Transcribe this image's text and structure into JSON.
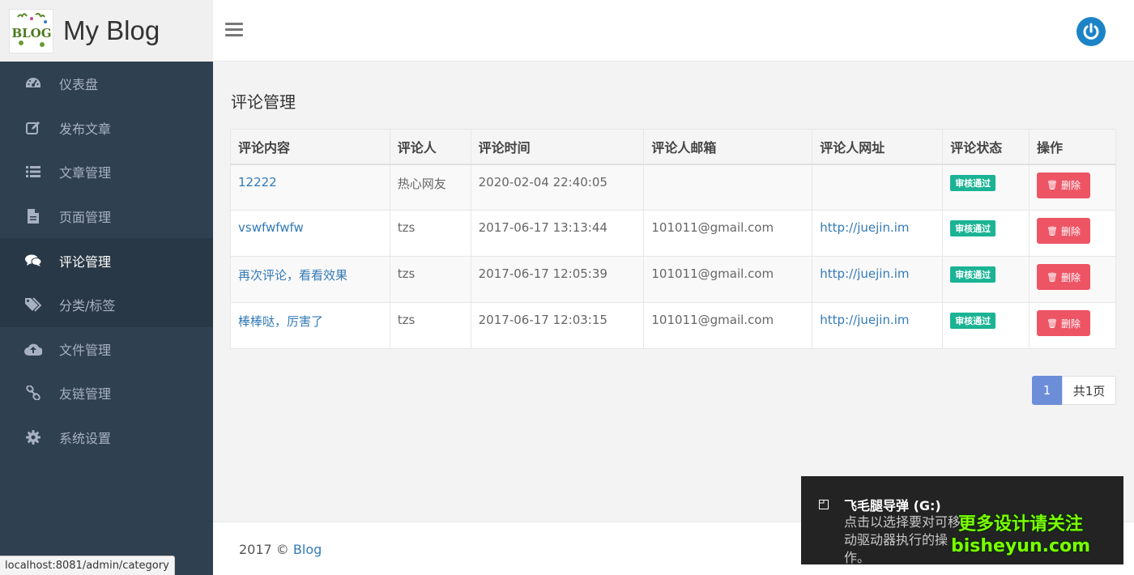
{
  "brand": {
    "title": "My Blog",
    "logo_text": "BLOG"
  },
  "sidebar": {
    "items": [
      {
        "label": "仪表盘",
        "icon": "dashboard-icon"
      },
      {
        "label": "发布文章",
        "icon": "edit-icon"
      },
      {
        "label": "文章管理",
        "icon": "list-icon"
      },
      {
        "label": "页面管理",
        "icon": "file-icon"
      },
      {
        "label": "评论管理",
        "icon": "comments-icon",
        "active": true
      },
      {
        "label": "分类/标签",
        "icon": "tags-icon"
      },
      {
        "label": "文件管理",
        "icon": "cloud-upload-icon"
      },
      {
        "label": "友链管理",
        "icon": "link-icon"
      },
      {
        "label": "系统设置",
        "icon": "gear-icon"
      }
    ]
  },
  "main": {
    "title": "评论管理",
    "table": {
      "headers": [
        "评论内容",
        "评论人",
        "评论时间",
        "评论人邮箱",
        "评论人网址",
        "评论状态",
        "操作"
      ],
      "rows": [
        {
          "content": "12222",
          "author": "热心网友",
          "time": "2020-02-04 22:40:05",
          "email": "",
          "url": "",
          "status": "审核通过",
          "action": "删除"
        },
        {
          "content": "vswfwfwfw",
          "author": "tzs",
          "time": "2017-06-17 13:13:44",
          "email": "101011@gmail.com",
          "url": "http://juejin.im",
          "status": "审核通过",
          "action": "删除"
        },
        {
          "content": "再次评论，看看效果",
          "author": "tzs",
          "time": "2017-06-17 12:05:39",
          "email": "101011@gmail.com",
          "url": "http://juejin.im",
          "status": "审核通过",
          "action": "删除"
        },
        {
          "content": "棒棒哒，厉害了",
          "author": "tzs",
          "time": "2017-06-17 12:03:15",
          "email": "101011@gmail.com",
          "url": "http://juejin.im",
          "status": "审核通过",
          "action": "删除"
        }
      ]
    },
    "pagination": {
      "current": "1",
      "total_label": "共1页"
    }
  },
  "footer": {
    "prefix": "2017 © ",
    "link": "Blog"
  },
  "statusbar": {
    "url": "localhost:8081/admin/category"
  },
  "toast": {
    "title": "飞毛腿导弹 (G:)",
    "body": "点击以选择要对可移动驱动器执行的操作。",
    "watermark_line1": "更多设计请关注",
    "watermark_line2": "bisheyun.com"
  },
  "colors": {
    "sidebar_bg": "#2f4050",
    "accent": "#1c84c6",
    "badge": "#1ab394",
    "danger": "#ed5565",
    "link": "#337ab7"
  }
}
